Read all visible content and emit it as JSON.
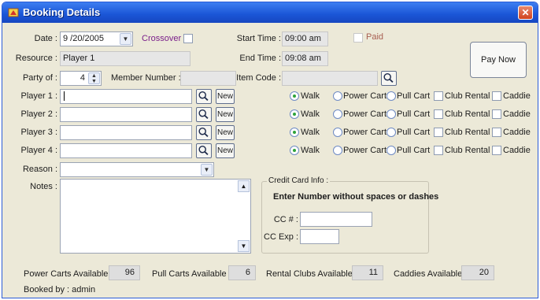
{
  "window": {
    "title": "Booking Details"
  },
  "labels": {
    "date": "Date :",
    "crossover": "Crossover",
    "start_time": "Start Time :",
    "paid": "Paid",
    "resource": "Resource :",
    "end_time": "End Time :",
    "party_of": "Party of :",
    "member_number": "Member Number :",
    "item_code": "Item Code :",
    "reason": "Reason :",
    "notes": "Notes :",
    "booked_by": "Booked by : admin"
  },
  "fields": {
    "date": "9 /20/2005",
    "start_time": "09:00 am",
    "end_time": "09:08 am",
    "resource": "Player 1",
    "party_of": "4",
    "member_number": "",
    "item_code": ""
  },
  "buttons": {
    "pay_now": "Pay Now",
    "new": "New"
  },
  "players": [
    {
      "label": "Player 1 :",
      "value": "",
      "selected": "walk"
    },
    {
      "label": "Player 2 :",
      "value": "",
      "selected": "walk"
    },
    {
      "label": "Player 3 :",
      "value": "",
      "selected": "walk"
    },
    {
      "label": "Player 4 :",
      "value": "",
      "selected": "walk"
    }
  ],
  "options": {
    "walk": "Walk",
    "power_cart": "Power Cart",
    "pull_cart": "Pull Cart",
    "club_rental": "Club Rental",
    "caddie": "Caddie"
  },
  "credit_card": {
    "legend": "Credit Card Info :",
    "instruction": "Enter Number without spaces or dashes",
    "cc_number_label": "CC # :",
    "cc_exp_label": "CC Exp :",
    "cc_number": "",
    "cc_exp": ""
  },
  "availability": {
    "power_carts_label": "Power Carts Available :",
    "power_carts": "96",
    "pull_carts_label": "Pull Carts Available :",
    "pull_carts": "6",
    "rental_clubs_label": "Rental Clubs Available :",
    "rental_clubs": "11",
    "caddies_label": "Caddies Available :",
    "caddies": "20"
  },
  "icons": {
    "title_icon": "golf-app-icon",
    "close": "close-icon",
    "lookup": "magnifier-icon",
    "dropdown": "chevron-down-icon",
    "spinner": "spinner-icon"
  }
}
